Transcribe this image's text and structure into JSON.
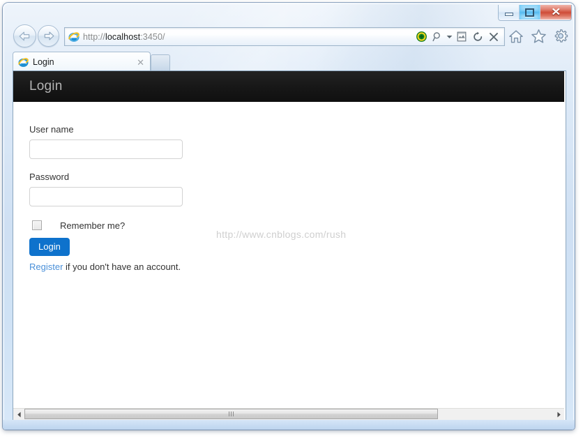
{
  "window": {
    "caption_buttons": [
      {
        "name": "minimize",
        "glyph": "minimize-glyph",
        "tooltip": "Minimize"
      },
      {
        "name": "restore",
        "glyph": "restore-glyph",
        "tooltip": "Restore Down"
      },
      {
        "name": "close",
        "glyph": "✕",
        "tooltip": "Close"
      }
    ]
  },
  "browser": {
    "nav": {
      "back_label": "Back",
      "forward_label": "Forward"
    },
    "address": {
      "favicon": "internet-explorer-icon",
      "url_full": "http://localhost:3450/",
      "url_scheme": "http://",
      "url_host": "localhost",
      "url_path": ":3450/",
      "icons": [
        {
          "name": "translate-addon-icon",
          "label": "Translate"
        },
        {
          "name": "search-icon",
          "label": "Search"
        },
        {
          "name": "chevron-down-icon",
          "label": "Search options"
        },
        {
          "name": "compatibility-view-icon",
          "label": "Compatibility View"
        },
        {
          "name": "refresh-icon",
          "label": "Refresh"
        },
        {
          "name": "stop-icon",
          "label": "Stop"
        }
      ]
    },
    "commands": [
      {
        "name": "home-icon",
        "label": "Home"
      },
      {
        "name": "favorites-star-icon",
        "label": "Favorites"
      },
      {
        "name": "tools-gear-icon",
        "label": "Tools"
      }
    ],
    "tabs": [
      {
        "title": "Login",
        "favicon": "internet-explorer-icon",
        "close_glyph": "✕",
        "active": true
      }
    ],
    "new_tab_label": "New Tab"
  },
  "page": {
    "brand": "Login",
    "form": {
      "username_label": "User name",
      "username_value": "",
      "username_placeholder": "",
      "password_label": "Password",
      "password_value": "",
      "password_placeholder": "",
      "remember_label": "Remember me?",
      "remember_checked": false,
      "submit_label": "Login",
      "register_link": "Register",
      "register_suffix": " if you don't have an account."
    },
    "watermark": "http://www.cnblogs.com/rush"
  },
  "scrollbar": {
    "left_arrow": "◄",
    "right_arrow": "►",
    "thumb_grip": "|||"
  },
  "colors": {
    "navbar_bg": "#1a1a1a",
    "brand_text": "#b3b3b3",
    "primary_button": "#0e72cc",
    "link": "#4a90d9",
    "watermark": "#cfcfcf",
    "chrome_blue": "#cfe0f3",
    "close_button_red": "#cf4c38"
  }
}
